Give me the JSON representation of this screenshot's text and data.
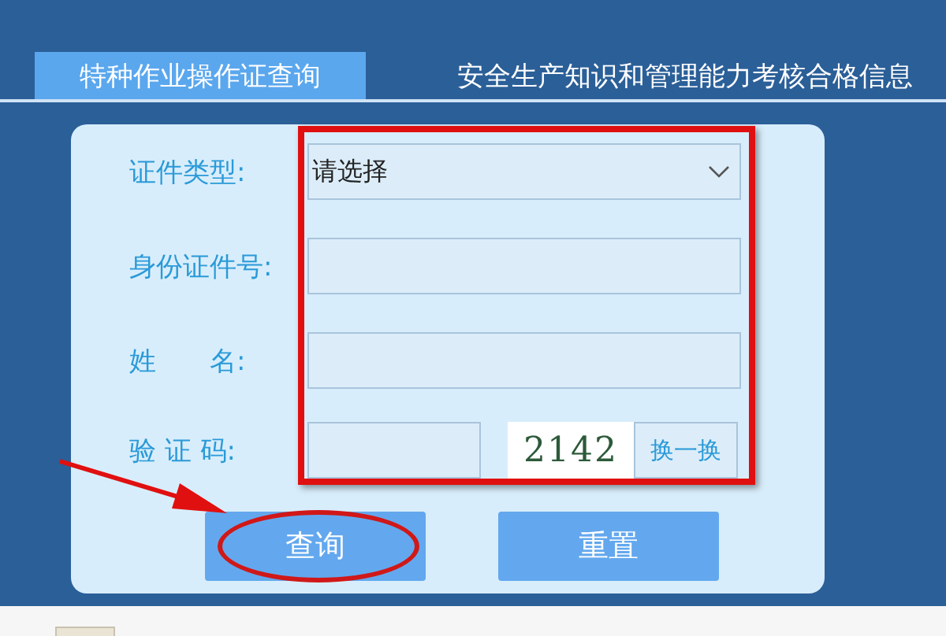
{
  "tabs": [
    {
      "label": "特种作业操作证查询",
      "selected": true
    },
    {
      "label": "安全生产知识和管理能力考核合格信息",
      "selected": false
    }
  ],
  "form": {
    "fields": [
      {
        "kind": "select",
        "label": "证件类型:",
        "value": "请选择"
      },
      {
        "kind": "text",
        "label": "身份证件号:"
      },
      {
        "kind": "text",
        "label": "姓　　名:"
      },
      {
        "kind": "captcha",
        "label": "验 证 码:",
        "captcha": "2142",
        "refresh": "换一换"
      }
    ]
  },
  "buttons": [
    {
      "label": "查询",
      "highlighted": true
    },
    {
      "label": "重置",
      "highlighted": false
    }
  ]
}
